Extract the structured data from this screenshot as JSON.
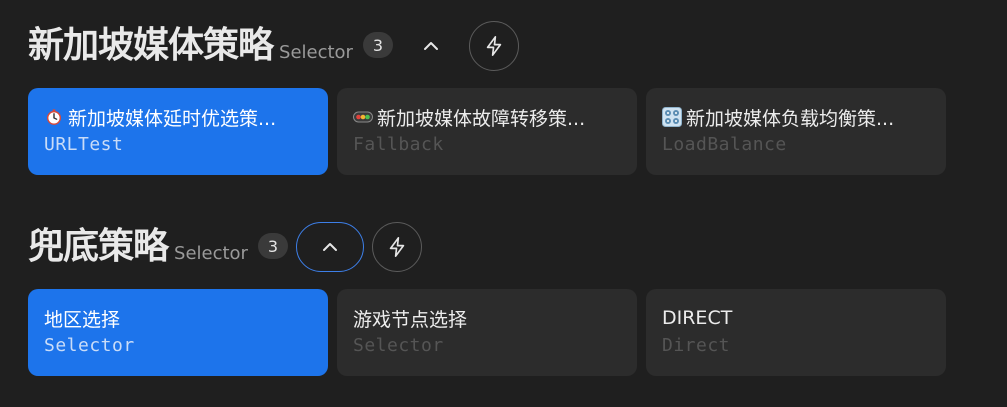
{
  "groups": [
    {
      "title": "新加坡媒体策略",
      "type": "Selector",
      "count": "3",
      "cards": [
        {
          "name": "新加坡媒体延时优选策...",
          "sub": "URLTest",
          "icon": "stopwatch-icon",
          "selected": true
        },
        {
          "name": "新加坡媒体故障转移策...",
          "sub": "Fallback",
          "icon": "traffic-light-icon",
          "selected": false
        },
        {
          "name": "新加坡媒体负载均衡策...",
          "sub": "LoadBalance",
          "icon": "control-knobs-icon",
          "selected": false
        }
      ]
    },
    {
      "title": "兜底策略",
      "type": "Selector",
      "count": "3",
      "cards": [
        {
          "name": "地区选择",
          "sub": "Selector",
          "selected": true
        },
        {
          "name": "游戏节点选择",
          "sub": "Selector",
          "selected": false
        },
        {
          "name": "DIRECT",
          "sub": "Direct",
          "selected": false
        }
      ]
    }
  ],
  "colors": {
    "background": "#1f1f1f",
    "card": "#2c2c2c",
    "selected": "#1d74eb",
    "focus_ring": "#3d7fe8"
  }
}
